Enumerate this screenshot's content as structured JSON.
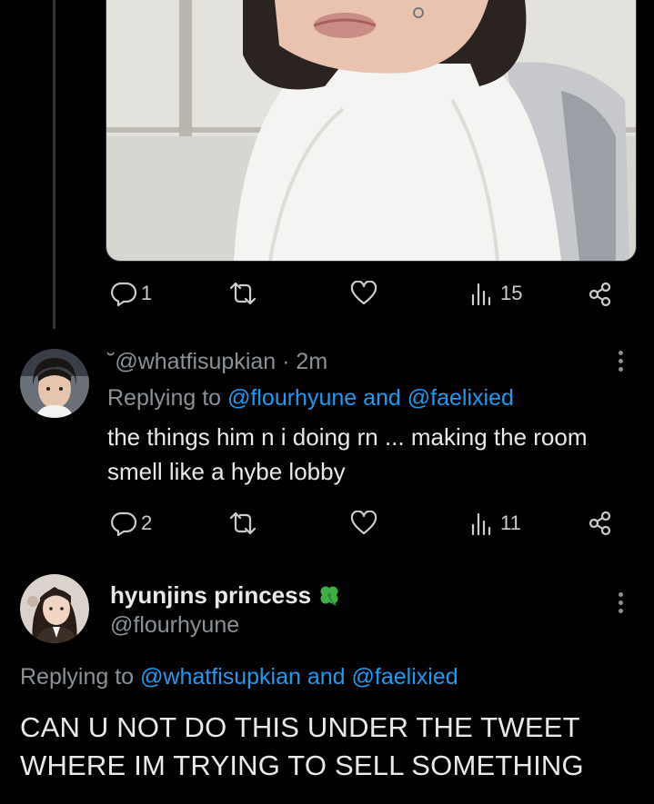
{
  "tweet1": {
    "actions": {
      "replies": "1",
      "retweets": "",
      "likes": "",
      "views": "15"
    }
  },
  "tweet2": {
    "prefix": "˘",
    "handle": "@whatfisupkian",
    "separator": "·",
    "time": "2m",
    "replying_prefix": "Replying to",
    "mention1": "@flourhyune",
    "and": "and",
    "mention2": "@faelixied",
    "text_line1": "the things him n i doing rn ... making the room",
    "text_line2": "smell like a hybe lobby",
    "actions": {
      "replies": "2",
      "retweets": "",
      "likes": "",
      "views": "11"
    }
  },
  "tweet3": {
    "display_name": "hyunjins princess",
    "badge_icon": "four-leaf-clover-icon",
    "handle": "@flourhyune",
    "replying_prefix": "Replying to",
    "mention1": "@whatfisupkian",
    "and": "and",
    "mention2": "@faelixied",
    "text_line1": "CAN U NOT DO THIS UNDER THE TWEET",
    "text_line2": "WHERE IM TRYING TO SELL SOMETHING"
  },
  "colors": {
    "background": "#000000",
    "text": "#e7e9ea",
    "muted": "#8b9196",
    "link": "#1d9bf0",
    "clover": "#3fae49"
  }
}
